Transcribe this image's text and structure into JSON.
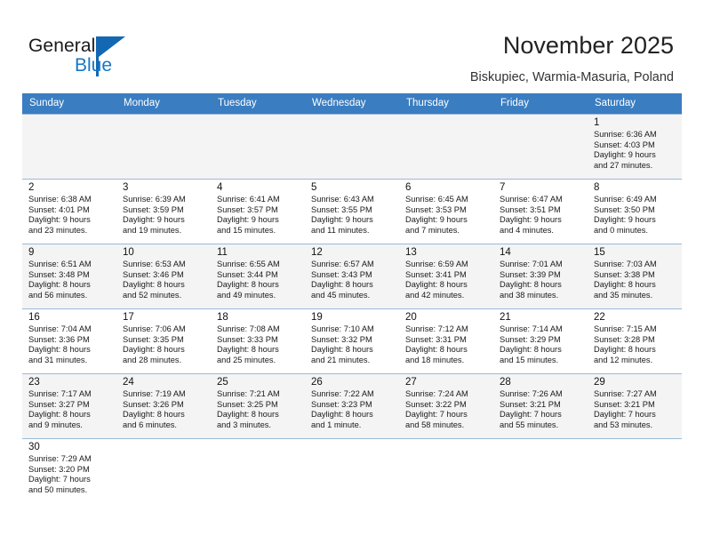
{
  "brand": {
    "name_top": "General",
    "name_bottom": "Blue",
    "accent_color": "#1268b3",
    "accent_color_light": "#1577c8"
  },
  "header": {
    "title": "November 2025",
    "subtitle": "Biskupiec, Warmia-Masuria, Poland"
  },
  "calendar": {
    "header_bg": "#3a7dc1",
    "weekdays": [
      "Sunday",
      "Monday",
      "Tuesday",
      "Wednesday",
      "Thursday",
      "Friday",
      "Saturday"
    ],
    "labels": {
      "sunrise": "Sunrise:",
      "sunset": "Sunset:",
      "daylight": "Daylight:"
    },
    "weeks": [
      [
        {
          "empty": true
        },
        {
          "empty": true
        },
        {
          "empty": true
        },
        {
          "empty": true
        },
        {
          "empty": true
        },
        {
          "empty": true
        },
        {
          "day": "1",
          "sunrise": "Sunrise: 6:36 AM",
          "sunset": "Sunset: 4:03 PM",
          "daylight_1": "Daylight: 9 hours",
          "daylight_2": "and 27 minutes."
        }
      ],
      [
        {
          "day": "2",
          "sunrise": "Sunrise: 6:38 AM",
          "sunset": "Sunset: 4:01 PM",
          "daylight_1": "Daylight: 9 hours",
          "daylight_2": "and 23 minutes."
        },
        {
          "day": "3",
          "sunrise": "Sunrise: 6:39 AM",
          "sunset": "Sunset: 3:59 PM",
          "daylight_1": "Daylight: 9 hours",
          "daylight_2": "and 19 minutes."
        },
        {
          "day": "4",
          "sunrise": "Sunrise: 6:41 AM",
          "sunset": "Sunset: 3:57 PM",
          "daylight_1": "Daylight: 9 hours",
          "daylight_2": "and 15 minutes."
        },
        {
          "day": "5",
          "sunrise": "Sunrise: 6:43 AM",
          "sunset": "Sunset: 3:55 PM",
          "daylight_1": "Daylight: 9 hours",
          "daylight_2": "and 11 minutes."
        },
        {
          "day": "6",
          "sunrise": "Sunrise: 6:45 AM",
          "sunset": "Sunset: 3:53 PM",
          "daylight_1": "Daylight: 9 hours",
          "daylight_2": "and 7 minutes."
        },
        {
          "day": "7",
          "sunrise": "Sunrise: 6:47 AM",
          "sunset": "Sunset: 3:51 PM",
          "daylight_1": "Daylight: 9 hours",
          "daylight_2": "and 4 minutes."
        },
        {
          "day": "8",
          "sunrise": "Sunrise: 6:49 AM",
          "sunset": "Sunset: 3:50 PM",
          "daylight_1": "Daylight: 9 hours",
          "daylight_2": "and 0 minutes."
        }
      ],
      [
        {
          "day": "9",
          "sunrise": "Sunrise: 6:51 AM",
          "sunset": "Sunset: 3:48 PM",
          "daylight_1": "Daylight: 8 hours",
          "daylight_2": "and 56 minutes."
        },
        {
          "day": "10",
          "sunrise": "Sunrise: 6:53 AM",
          "sunset": "Sunset: 3:46 PM",
          "daylight_1": "Daylight: 8 hours",
          "daylight_2": "and 52 minutes."
        },
        {
          "day": "11",
          "sunrise": "Sunrise: 6:55 AM",
          "sunset": "Sunset: 3:44 PM",
          "daylight_1": "Daylight: 8 hours",
          "daylight_2": "and 49 minutes."
        },
        {
          "day": "12",
          "sunrise": "Sunrise: 6:57 AM",
          "sunset": "Sunset: 3:43 PM",
          "daylight_1": "Daylight: 8 hours",
          "daylight_2": "and 45 minutes."
        },
        {
          "day": "13",
          "sunrise": "Sunrise: 6:59 AM",
          "sunset": "Sunset: 3:41 PM",
          "daylight_1": "Daylight: 8 hours",
          "daylight_2": "and 42 minutes."
        },
        {
          "day": "14",
          "sunrise": "Sunrise: 7:01 AM",
          "sunset": "Sunset: 3:39 PM",
          "daylight_1": "Daylight: 8 hours",
          "daylight_2": "and 38 minutes."
        },
        {
          "day": "15",
          "sunrise": "Sunrise: 7:03 AM",
          "sunset": "Sunset: 3:38 PM",
          "daylight_1": "Daylight: 8 hours",
          "daylight_2": "and 35 minutes."
        }
      ],
      [
        {
          "day": "16",
          "sunrise": "Sunrise: 7:04 AM",
          "sunset": "Sunset: 3:36 PM",
          "daylight_1": "Daylight: 8 hours",
          "daylight_2": "and 31 minutes."
        },
        {
          "day": "17",
          "sunrise": "Sunrise: 7:06 AM",
          "sunset": "Sunset: 3:35 PM",
          "daylight_1": "Daylight: 8 hours",
          "daylight_2": "and 28 minutes."
        },
        {
          "day": "18",
          "sunrise": "Sunrise: 7:08 AM",
          "sunset": "Sunset: 3:33 PM",
          "daylight_1": "Daylight: 8 hours",
          "daylight_2": "and 25 minutes."
        },
        {
          "day": "19",
          "sunrise": "Sunrise: 7:10 AM",
          "sunset": "Sunset: 3:32 PM",
          "daylight_1": "Daylight: 8 hours",
          "daylight_2": "and 21 minutes."
        },
        {
          "day": "20",
          "sunrise": "Sunrise: 7:12 AM",
          "sunset": "Sunset: 3:31 PM",
          "daylight_1": "Daylight: 8 hours",
          "daylight_2": "and 18 minutes."
        },
        {
          "day": "21",
          "sunrise": "Sunrise: 7:14 AM",
          "sunset": "Sunset: 3:29 PM",
          "daylight_1": "Daylight: 8 hours",
          "daylight_2": "and 15 minutes."
        },
        {
          "day": "22",
          "sunrise": "Sunrise: 7:15 AM",
          "sunset": "Sunset: 3:28 PM",
          "daylight_1": "Daylight: 8 hours",
          "daylight_2": "and 12 minutes."
        }
      ],
      [
        {
          "day": "23",
          "sunrise": "Sunrise: 7:17 AM",
          "sunset": "Sunset: 3:27 PM",
          "daylight_1": "Daylight: 8 hours",
          "daylight_2": "and 9 minutes."
        },
        {
          "day": "24",
          "sunrise": "Sunrise: 7:19 AM",
          "sunset": "Sunset: 3:26 PM",
          "daylight_1": "Daylight: 8 hours",
          "daylight_2": "and 6 minutes."
        },
        {
          "day": "25",
          "sunrise": "Sunrise: 7:21 AM",
          "sunset": "Sunset: 3:25 PM",
          "daylight_1": "Daylight: 8 hours",
          "daylight_2": "and 3 minutes."
        },
        {
          "day": "26",
          "sunrise": "Sunrise: 7:22 AM",
          "sunset": "Sunset: 3:23 PM",
          "daylight_1": "Daylight: 8 hours",
          "daylight_2": "and 1 minute."
        },
        {
          "day": "27",
          "sunrise": "Sunrise: 7:24 AM",
          "sunset": "Sunset: 3:22 PM",
          "daylight_1": "Daylight: 7 hours",
          "daylight_2": "and 58 minutes."
        },
        {
          "day": "28",
          "sunrise": "Sunrise: 7:26 AM",
          "sunset": "Sunset: 3:21 PM",
          "daylight_1": "Daylight: 7 hours",
          "daylight_2": "and 55 minutes."
        },
        {
          "day": "29",
          "sunrise": "Sunrise: 7:27 AM",
          "sunset": "Sunset: 3:21 PM",
          "daylight_1": "Daylight: 7 hours",
          "daylight_2": "and 53 minutes."
        }
      ],
      [
        {
          "day": "30",
          "sunrise": "Sunrise: 7:29 AM",
          "sunset": "Sunset: 3:20 PM",
          "daylight_1": "Daylight: 7 hours",
          "daylight_2": "and 50 minutes."
        },
        {
          "empty": true
        },
        {
          "empty": true
        },
        {
          "empty": true
        },
        {
          "empty": true
        },
        {
          "empty": true
        },
        {
          "empty": true
        }
      ]
    ]
  }
}
